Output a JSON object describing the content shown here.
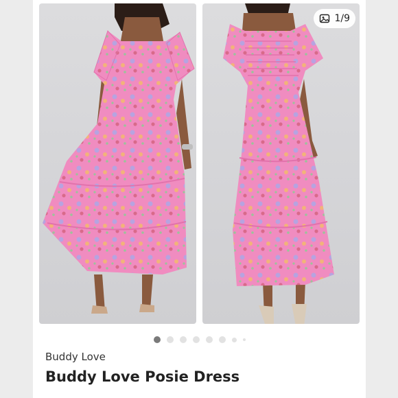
{
  "gallery": {
    "counter": "1/9",
    "image_count": 9,
    "active_index": 1
  },
  "listing": {
    "brand": "Buddy Love",
    "title": "Buddy Love Posie Dress"
  },
  "colors": {
    "dress_pink": "#f08cc0",
    "background": "#ffffff",
    "active_dot": "#7a7a7a"
  }
}
